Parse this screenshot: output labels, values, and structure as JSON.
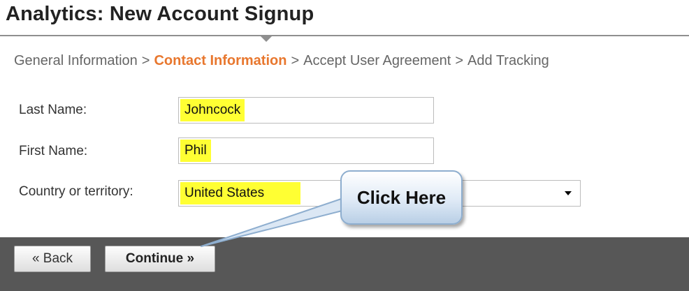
{
  "page": {
    "title": "Analytics: New Account Signup"
  },
  "breadcrumb": {
    "steps": [
      "General Information",
      "Contact Information",
      "Accept User Agreement",
      "Add Tracking"
    ],
    "separator": ">",
    "active_step": "Contact Information"
  },
  "form": {
    "last_name": {
      "label": "Last Name:",
      "value": "Johncock"
    },
    "first_name": {
      "label": "First Name:",
      "value": "Phil"
    },
    "country": {
      "label": "Country or territory:",
      "value": "United States"
    }
  },
  "buttons": {
    "back": "« Back",
    "continue": "Continue »"
  },
  "callout": {
    "text": "Click Here"
  },
  "colors": {
    "active_step": "#e8772e",
    "field_highlight": "#ffff33",
    "button_bar": "#575757",
    "callout_border": "#8eaecf"
  },
  "icons": {
    "dropdown": "chevron-down-icon"
  }
}
